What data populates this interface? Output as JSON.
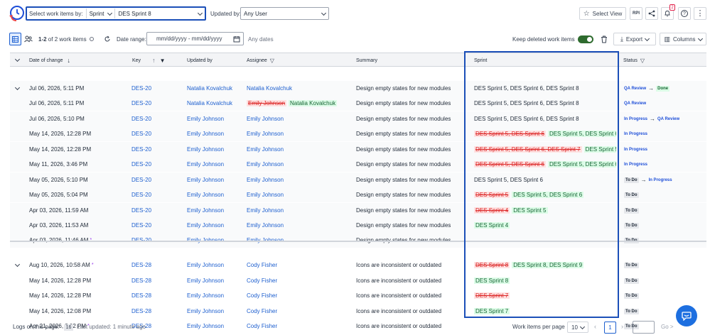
{
  "header": {
    "select_label": "Select work items by:",
    "select_type": "Sprint",
    "select_value": "DES Sprint 8",
    "updated_by_label": "Updated by:",
    "updated_by_value": "Any User",
    "select_view_label": "Select View",
    "rpi_label": "RPI",
    "notification_count": "2"
  },
  "toolbar": {
    "count_text_prefix": "1-2",
    "count_text_suffix": "of 2 work items",
    "date_range_label": "Date range:",
    "date_placeholder": "mm/dd/yyyy - mm/dd/yyyy",
    "any_dates": "Any dates",
    "keep_deleted_label": "Keep deleted work items",
    "export_label": "Export",
    "columns_label": "Columns"
  },
  "columns": {
    "date": "Date of change",
    "key": "Key",
    "updated_by": "Updated by",
    "assignee": "Assignee",
    "summary": "Summary",
    "sprint": "Sprint",
    "status": "Status"
  },
  "rows": [
    {
      "date": "Jul 06, 2026, 5:11 PM",
      "key": "DES-20",
      "updated_by": "Natalia Kovalchuk",
      "assignee_old": "",
      "assignee": "Natalia Kovalchuk",
      "summary": "Design empty states for new modules",
      "sprint_old": "",
      "sprint": "DES Sprint 5, DES Sprint 6, DES Sprint 8",
      "sprint_added": "",
      "status_from": "QA Review",
      "status_to": "Done"
    },
    {
      "date": "Jul 06, 2026, 5:11 PM",
      "key": "DES-20",
      "updated_by": "Natalia Kovalchuk",
      "assignee_old": "Emily Johnson",
      "assignee": "Natalia Kovalchuk",
      "summary": "Design empty states for new modules",
      "sprint_old": "",
      "sprint": "DES Sprint 5, DES Sprint 6, DES Sprint 8",
      "sprint_added": "",
      "status_from": "QA Review",
      "status_to": ""
    },
    {
      "date": "Jul 06, 2026, 5:10 PM",
      "key": "DES-20",
      "updated_by": "Emily Johnson",
      "assignee_old": "",
      "assignee": "Emily Johnson",
      "summary": "Design empty states for new modules",
      "sprint_old": "",
      "sprint": "DES Sprint 5, DES Sprint 6, DES Sprint 8",
      "sprint_added": "",
      "status_from": "In Progress",
      "status_to": "QA Review"
    },
    {
      "date": "May 14, 2026, 12:28 PM",
      "key": "DES-20",
      "updated_by": "Emily Johnson",
      "assignee_old": "",
      "assignee": "Emily Johnson",
      "summary": "Design empty states for new modules",
      "sprint_old": "DES Sprint 5, DES Sprint 6",
      "sprint": "",
      "sprint_added": "DES Sprint 5, DES Sprint 6, ...",
      "status_from": "In Progress",
      "status_to": ""
    },
    {
      "date": "May 14, 2026, 12:28 PM",
      "key": "DES-20",
      "updated_by": "Emily Johnson",
      "assignee_old": "",
      "assignee": "Emily Johnson",
      "summary": "Design empty states for new modules",
      "sprint_old": "DES Sprint 5, DES Sprint 6, DES Sprint 7",
      "sprint": "",
      "sprint_added": "DES Sprint 5, ...",
      "status_from": "In Progress",
      "status_to": ""
    },
    {
      "date": "May 11, 2026, 3:46 PM",
      "key": "DES-20",
      "updated_by": "Emily Johnson",
      "assignee_old": "",
      "assignee": "Emily Johnson",
      "summary": "Design empty states for new modules",
      "sprint_old": "DES Sprint 5, DES Sprint 6",
      "sprint": "",
      "sprint_added": "DES Sprint 5, DES Sprint 6, ...",
      "status_from": "In Progress",
      "status_to": ""
    },
    {
      "date": "May 05, 2026, 5:10 PM",
      "key": "DES-20",
      "updated_by": "Emily Johnson",
      "assignee_old": "",
      "assignee": "Emily Johnson",
      "summary": "Design empty states for new modules",
      "sprint_old": "",
      "sprint": "DES Sprint 5, DES Sprint 6",
      "sprint_added": "",
      "status_from": "To Do",
      "status_to": "In Progress"
    },
    {
      "date": "May 05, 2026, 5:04 PM",
      "key": "DES-20",
      "updated_by": "Emily Johnson",
      "assignee_old": "",
      "assignee": "Emily Johnson",
      "summary": "Design empty states for new modules",
      "sprint_old": "DES Sprint 5",
      "sprint": "",
      "sprint_added": "DES Sprint 5, DES Sprint 6",
      "status_from": "To Do",
      "status_to": ""
    },
    {
      "date": "Apr 03, 2026, 11:59 AM",
      "key": "DES-20",
      "updated_by": "Emily Johnson",
      "assignee_old": "",
      "assignee": "Emily Johnson",
      "summary": "Design empty states for new modules",
      "sprint_old": "DES Sprint 4",
      "sprint": "",
      "sprint_added": "DES Sprint 5",
      "status_from": "To Do",
      "status_to": ""
    },
    {
      "date": "Apr 03, 2026, 11:53 AM",
      "key": "DES-20",
      "updated_by": "Emily Johnson",
      "assignee_old": "",
      "assignee": "Emily Johnson",
      "summary": "Design empty states for new modules",
      "sprint_old": "",
      "sprint": "",
      "sprint_added": "DES Sprint 4",
      "status_from": "To Do",
      "status_to": ""
    },
    {
      "date": "Apr 03, 2026, 11:46 AM",
      "key": "DES-20",
      "updated_by": "Emily Johnson",
      "assignee_old": "",
      "assignee": "Emily Johnson",
      "summary": "Design empty states for new modules",
      "sprint_old": "",
      "sprint": "",
      "sprint_added": "",
      "status_from": "To Do",
      "status_to": ""
    },
    {
      "date": "Aug 10, 2026, 10:58 AM",
      "key": "DES-28",
      "updated_by": "Emily Johnson",
      "assignee_old": "",
      "assignee": "Cody Fisher",
      "summary": "Icons are inconsistent or outdated",
      "sprint_old": "DES Sprint 8",
      "sprint": "",
      "sprint_added": "DES Sprint 8, DES Sprint 9",
      "status_from": "To Do",
      "status_to": ""
    },
    {
      "date": "May 14, 2026, 12:28 PM",
      "key": "DES-28",
      "updated_by": "Emily Johnson",
      "assignee_old": "",
      "assignee": "Cody Fisher",
      "summary": "Icons are inconsistent or outdated",
      "sprint_old": "",
      "sprint": "",
      "sprint_added": "DES Sprint 8",
      "status_from": "To Do",
      "status_to": ""
    },
    {
      "date": "May 14, 2026, 12:28 PM",
      "key": "DES-28",
      "updated_by": "Emily Johnson",
      "assignee_old": "",
      "assignee": "Cody Fisher",
      "summary": "Icons are inconsistent or outdated",
      "sprint_old": "DES Sprint 7",
      "sprint": "",
      "sprint_added": "",
      "status_from": "To Do",
      "status_to": ""
    },
    {
      "date": "May 14, 2026, 12:08 PM",
      "key": "DES-28",
      "updated_by": "Emily Johnson",
      "assignee_old": "",
      "assignee": "Cody Fisher",
      "summary": "Icons are inconsistent or outdated",
      "sprint_old": "",
      "sprint": "",
      "sprint_added": "DES Sprint 7",
      "status_from": "To Do",
      "status_to": ""
    },
    {
      "date": "Apr 21, 2026, 2:02 PM",
      "key": "DES-28",
      "updated_by": "Emily Johnson",
      "assignee_old": "",
      "assignee": "Cody Fisher",
      "summary": "Icons are inconsistent or outdated",
      "sprint_old": "",
      "sprint": "",
      "sprint_added": "",
      "status_from": "To Do",
      "status_to": ""
    }
  ],
  "footer": {
    "logs_label": "Logs on this page:",
    "logs_count": "16",
    "last_updated": "Last updated: 1 minute ago",
    "per_page_label": "Work items per page",
    "per_page_value": "10",
    "current_page": "1",
    "go_label": "Go >"
  },
  "colors": {
    "accent": "#1b4fb8",
    "link": "#1d5fcf",
    "removed": "#dc2626",
    "added": "#166534",
    "toggle_on": "#2e6b2e"
  }
}
